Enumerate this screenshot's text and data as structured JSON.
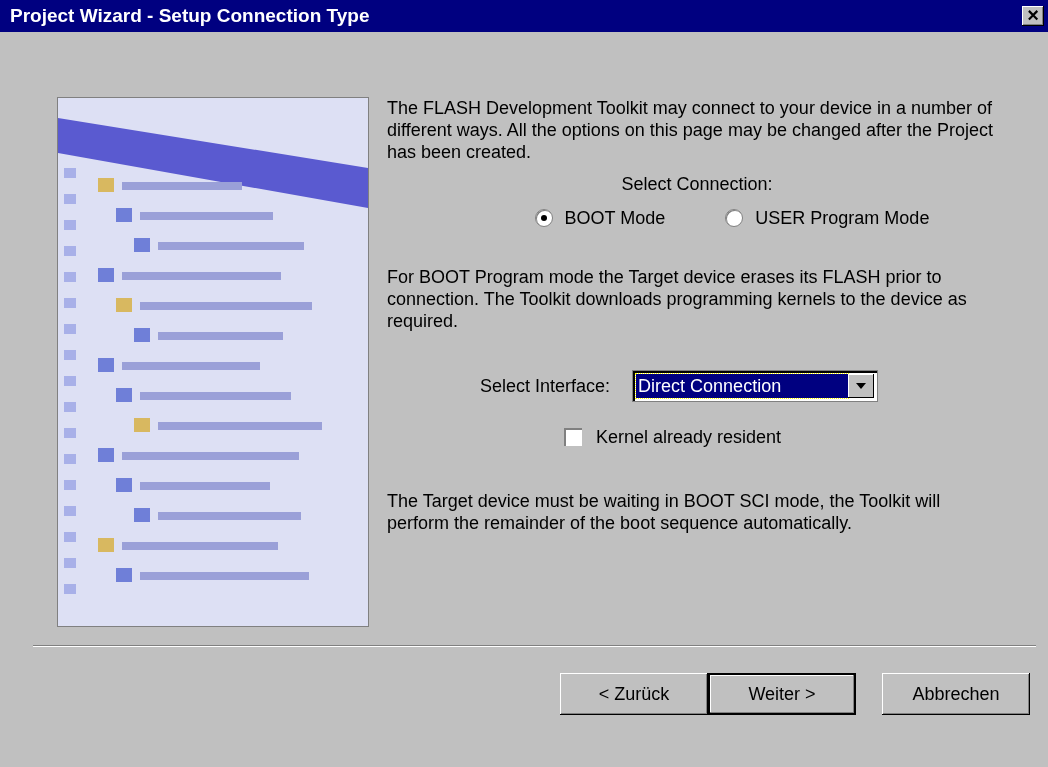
{
  "window": {
    "title": "Project Wizard - Setup Connection Type",
    "close": "×"
  },
  "intro": "The FLASH Development Toolkit may connect to your device in a number of different ways. All the options on this page may be changed after the Project has been created.",
  "connection": {
    "label": "Select Connection:",
    "options": [
      {
        "label": "BOOT Mode",
        "selected": true
      },
      {
        "label": "USER Program Mode",
        "selected": false
      }
    ]
  },
  "mode_description": "For BOOT Program mode the Target device erases its FLASH prior to connection. The Toolkit downloads programming kernels to the device as required.",
  "interface": {
    "label": "Select Interface:",
    "value": "Direct Connection",
    "focused": true
  },
  "kernel_resident": {
    "label": "Kernel already resident",
    "checked": false
  },
  "note": "The Target device must be waiting in BOOT SCI mode, the Toolkit will perform the remainder of the boot sequence automatically.",
  "buttons": [
    {
      "label": "< Zurück",
      "default": false
    },
    {
      "label": "Weiter >",
      "default": true
    },
    {
      "label": "Abbrechen",
      "default": false
    }
  ]
}
